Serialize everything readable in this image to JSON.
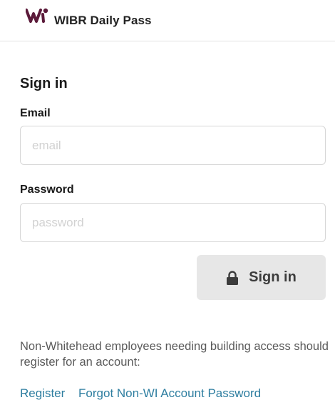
{
  "header": {
    "logo_icon": "wi-logo-icon",
    "title": "WIBR Daily Pass",
    "logo_color": "#5b1a3a"
  },
  "form": {
    "title": "Sign in",
    "email": {
      "label": "Email",
      "placeholder": "email",
      "value": ""
    },
    "password": {
      "label": "Password",
      "placeholder": "password",
      "value": ""
    },
    "submit": {
      "icon": "lock-icon",
      "label": "Sign in"
    }
  },
  "footer": {
    "note": "Non-Whitehead employees needing building access should register for an account:",
    "links": [
      {
        "label": "Register"
      },
      {
        "label": "Forgot Non-WI Account Password"
      }
    ],
    "link_color": "#2e7ea0"
  }
}
